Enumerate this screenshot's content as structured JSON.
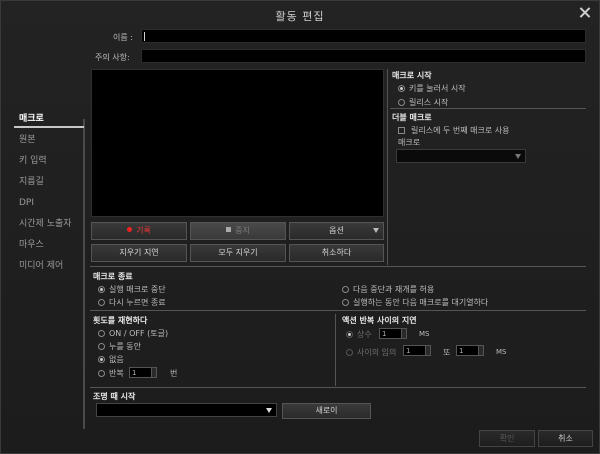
{
  "window": {
    "title": "활동 편집"
  },
  "sidebar": {
    "items": [
      {
        "label": "매크로",
        "active": true
      },
      {
        "label": "원본"
      },
      {
        "label": "키 입력"
      },
      {
        "label": "지름길"
      },
      {
        "label": "DPI"
      },
      {
        "label": "시간제 노출자"
      },
      {
        "label": "마우스"
      },
      {
        "label": "미디어 제어"
      }
    ]
  },
  "form": {
    "name_label": "이름 :",
    "name_value": "",
    "notes_label": "주의 사항:",
    "notes_value": ""
  },
  "editor_buttons": {
    "record": "기록",
    "stop": "중지",
    "options": "옵션",
    "clear_delay": "지우기 지연",
    "clear_all": "모두 지우기",
    "cancel": "취소하다"
  },
  "macro_start": {
    "heading": "매크로 시작",
    "options": [
      "키를 눌러서 시작",
      "릴리스 시작"
    ],
    "selected": 0
  },
  "double_macro": {
    "heading": "더블 매크로",
    "checkbox_label": "릴리스에 두 번째 매크로 사용",
    "macro_label": "매크로",
    "macro_value": ""
  },
  "macro_end": {
    "heading": "매크로 종료",
    "options_left": [
      "실행 매크로 중단",
      "다시 누르면 종료"
    ],
    "options_right": [
      "다음 중단과 재개를 허용",
      "실행하는 동안 다음 매크로를 대기열하다"
    ],
    "selected": "실행 매크로 중단"
  },
  "repeat": {
    "heading": "횟도를 재현하다",
    "options": [
      "ON / OFF (토글)",
      "누를 동안",
      "없음",
      "반복"
    ],
    "selected": "없음",
    "repeat_count": "1",
    "repeat_unit": "번"
  },
  "action_delay": {
    "heading": "액션 반복 사이의 지연",
    "constant_label": "상수",
    "constant_value": "1",
    "constant_unit": "MS",
    "random_label": "사이의 임의",
    "random_from": "1",
    "random_and": "또",
    "random_to": "1",
    "random_unit": "MS"
  },
  "lighting": {
    "heading": "조명 때 시작",
    "value": "",
    "new_button": "새로이"
  },
  "footer": {
    "confirm": "확인",
    "cancel": "취소"
  },
  "colors": {
    "background": "#1b1b1b",
    "record_accent": "#e22222"
  }
}
